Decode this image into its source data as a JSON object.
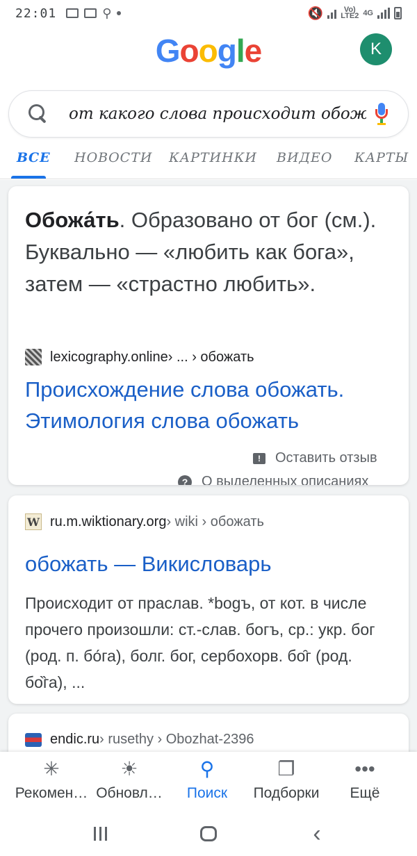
{
  "status_bar": {
    "time": "22:01",
    "network_top": "Vo)",
    "network_bottom": "LTE2",
    "network_gen": "4G"
  },
  "header": {
    "logo_letters": [
      "G",
      "o",
      "o",
      "g",
      "l",
      "e"
    ],
    "logo_colors": [
      "#4285f4",
      "#ea4335",
      "#fbbc05",
      "#4285f4",
      "#34a853",
      "#ea4335"
    ],
    "avatar_initial": "K"
  },
  "search": {
    "query": "от какого слова происходит обожать"
  },
  "tabs": [
    {
      "label": "ВСЕ",
      "active": true
    },
    {
      "label": "НОВОСТИ"
    },
    {
      "label": "КАРТИНКИ"
    },
    {
      "label": "ВИДЕО"
    },
    {
      "label": "КАРТЫ"
    }
  ],
  "featured_snippet": {
    "term": "Обожа́ть",
    "text": ". Образовано от бог (см.). Буквально — «любить как бога», затем — «страстно любить».",
    "source_domain": "lexicography.online",
    "source_path": " › ... › обожать",
    "link_title": "Происхождение слова обожать. Этимология слова обожать",
    "feedback_label": "Оставить отзыв",
    "about_label": "О выделенных описаниях"
  },
  "result_wiki": {
    "favicon_letter": "W",
    "domain": "ru.m.wiktionary.org",
    "path": " › wiki › обожать",
    "title": "обожать — Викисловарь",
    "description": "Происходит от праслав. *bogъ, от кот. в числе прочего произошли: ст.-слав. богъ, ср.: укр. бог (род. п. бо́га), болг. бог, сербохорв. бо̑г (род. бо̏га), ..."
  },
  "result_endic": {
    "domain": "endic.ru",
    "path": " › rusethy › Obozhat-2396"
  },
  "bottom_nav": [
    {
      "label": "Рекомен…",
      "icon": "asterisk-icon"
    },
    {
      "label": "Обновл…",
      "icon": "updates-icon"
    },
    {
      "label": "Поиск",
      "icon": "search-icon",
      "active": true
    },
    {
      "label": "Подборки",
      "icon": "collections-icon"
    },
    {
      "label": "Ещё",
      "icon": "more-icon"
    }
  ],
  "colors": {
    "accent": "#1a73e8",
    "link": "#1a5fc7",
    "avatar_bg": "#1e8e6e"
  }
}
